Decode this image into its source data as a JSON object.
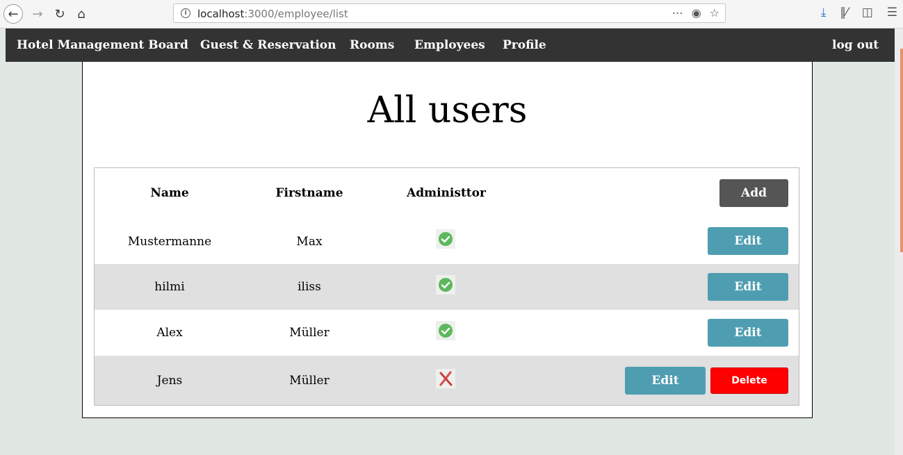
{
  "browser": {
    "url_host": "localhost",
    "url_path": ":3000/employee/list"
  },
  "nav": {
    "brand": "Hotel Management Board",
    "items": [
      "Guest & Reservation",
      "Rooms",
      "Employees",
      "Profile"
    ],
    "logout": "log out"
  },
  "page": {
    "title": "All users"
  },
  "table": {
    "headers": {
      "name": "Name",
      "firstname": "Firstname",
      "admin": "Administtor"
    },
    "add_label": "Add",
    "edit_label": "Edit",
    "delete_label": "Delete",
    "rows": [
      {
        "name": "Mustermanne",
        "firstname": "Max",
        "admin": true
      },
      {
        "name": "hilmi",
        "firstname": "iliss",
        "admin": true
      },
      {
        "name": "Alex",
        "firstname": "Müller",
        "admin": true
      },
      {
        "name": "Jens",
        "firstname": "Müller",
        "admin": false
      }
    ]
  },
  "colors": {
    "nav_bg": "#333333",
    "edit_button": "#4f9db1",
    "delete_button": "#ff0000",
    "add_button": "#555555",
    "check_green": "#5cb85c",
    "cross_red": "#d9534f"
  }
}
